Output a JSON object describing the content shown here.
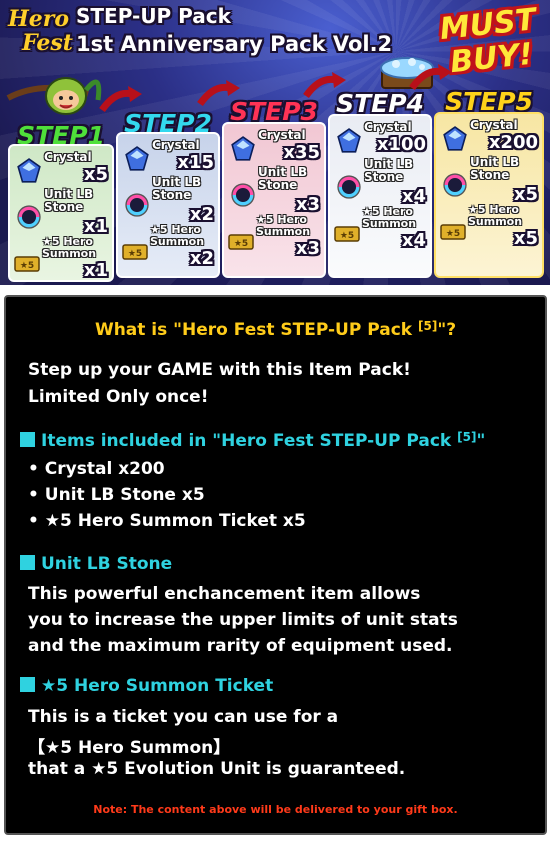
{
  "banner": {
    "logo_line1": "Hero",
    "logo_line2": "Fest",
    "title_line1": "STEP-UP Pack",
    "title_line2": "1st Anniversary Pack Vol.2",
    "must_line1": "MUST",
    "must_line2": "BUY!",
    "steps": [
      {
        "label": "STEP1",
        "crystal": "Crystal",
        "crystal_qty": "x5",
        "lb": "Unit LB Stone",
        "lb_qty": "x1",
        "summon": "★5 Hero Summon",
        "summon_qty": "x1"
      },
      {
        "label": "STEP2",
        "crystal": "Crystal",
        "crystal_qty": "x15",
        "lb": "Unit LB Stone",
        "lb_qty": "x2",
        "summon": "★5 Hero Summon",
        "summon_qty": "x2"
      },
      {
        "label": "STEP3",
        "crystal": "Crystal",
        "crystal_qty": "x35",
        "lb": "Unit LB Stone",
        "lb_qty": "x3",
        "summon": "★5 Hero Summon",
        "summon_qty": "x3"
      },
      {
        "label": "STEP4",
        "crystal": "Crystal",
        "crystal_qty": "x100",
        "lb": "Unit LB Stone",
        "lb_qty": "x4",
        "summon": "★5 Hero Summon",
        "summon_qty": "x4"
      },
      {
        "label": "STEP5",
        "crystal": "Crystal",
        "crystal_qty": "x200",
        "lb": "Unit LB Stone",
        "lb_qty": "x5",
        "summon": "★5 Hero Summon",
        "summon_qty": "x5"
      }
    ],
    "colors": {
      "step1": "#4fe03a",
      "step2": "#33d8ee",
      "step3": "#ff3355",
      "step4": "#ffffff",
      "step5": "#ffd21a"
    }
  },
  "panel": {
    "question": "What is \"Hero Fest STEP-UP Pack ",
    "question_sup": "[5]",
    "question_end": "\"?",
    "intro_line1": "Step up your GAME with this Item Pack!",
    "intro_line2": "Limited Only once!",
    "items_heading": "Items included in \"Hero Fest STEP-UP Pack ",
    "items_heading_sup": "[5]",
    "items_heading_end": "\"",
    "items": [
      "• Crystal x200",
      "• Unit LB Stone x5",
      "• ★5 Hero Summon Ticket x5"
    ],
    "lb_heading": "Unit LB Stone",
    "lb_line1": "This powerful enchancement item allows",
    "lb_line2": "you to increase the upper limits of unit stats",
    "lb_line3": "and the maximum rarity of equipment used.",
    "ticket_heading": "★5 Hero Summon Ticket",
    "ticket_line1": "This is a ticket you can use for a",
    "ticket_line2": "【★5 Hero Summon】",
    "ticket_line3": "that a ★5 Evolution Unit is guaranteed.",
    "note": "Note: The content above will be delivered to your gift box."
  }
}
